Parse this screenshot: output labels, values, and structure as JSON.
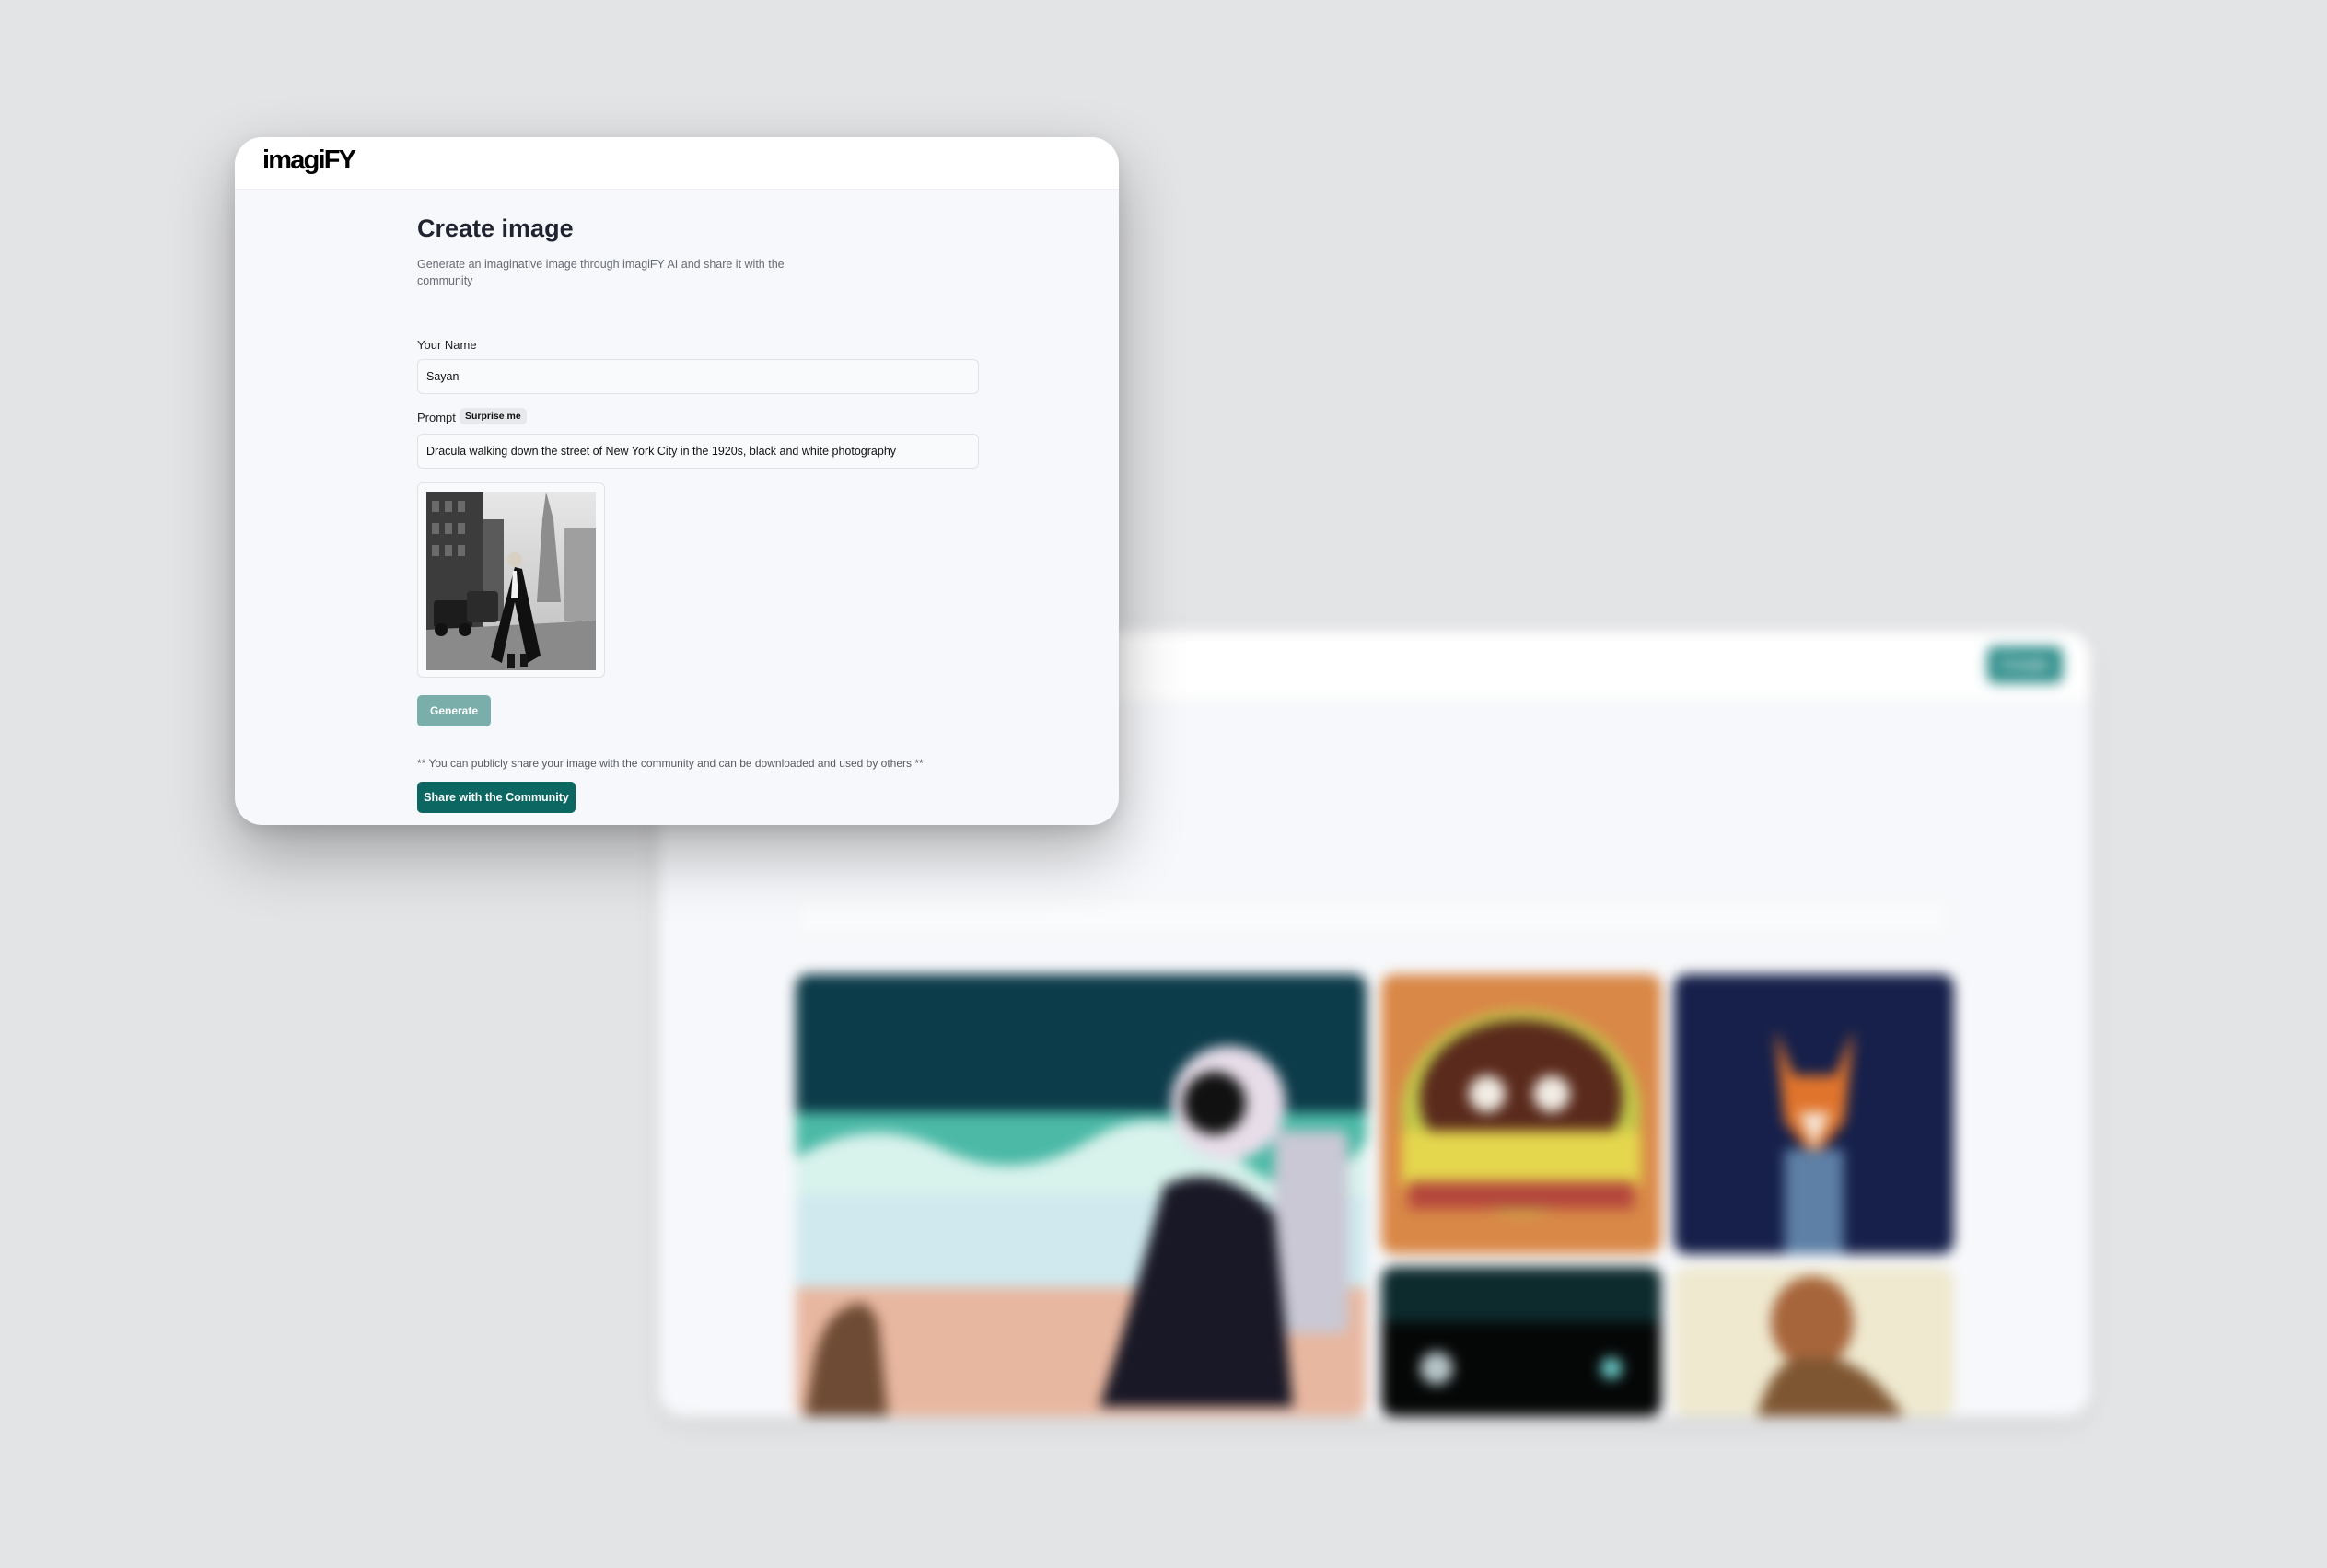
{
  "colors": {
    "page_background": "#e3e4e6",
    "window_background": "#f7f8fb",
    "header_background": "#ffffff",
    "generate_button": "#79aeab",
    "share_button": "#0c6662",
    "accent_blurred_create": "#2e8d8a"
  },
  "header": {
    "logo": "imagiFY"
  },
  "create_page": {
    "title": "Create image",
    "subtitle": "Generate an imaginative image through imagiFY AI and share it with the community",
    "name_field": {
      "label": "Your Name",
      "value": "Sayan"
    },
    "prompt_field": {
      "label": "Prompt",
      "surprise_label": "Surprise me",
      "value": "Dracula walking down the street of New York City in the 1920s, black and white photography"
    },
    "preview": {
      "alt": "preview",
      "icon": "generated-image"
    },
    "generate_label": "Generate",
    "share_note": "** You can publicly share your image with the community and can be downloaded and used by others **",
    "share_label": "Share with the Community"
  },
  "background_window": {
    "blurred": true,
    "create_label": "Create",
    "tiles": [
      {
        "icon": "astronaut-cat-beach-image"
      },
      {
        "icon": "food-bowl-image"
      },
      {
        "icon": "fox-space-image"
      },
      {
        "icon": "astronaut-night-image"
      },
      {
        "icon": "monkey-portrait-image"
      }
    ]
  }
}
